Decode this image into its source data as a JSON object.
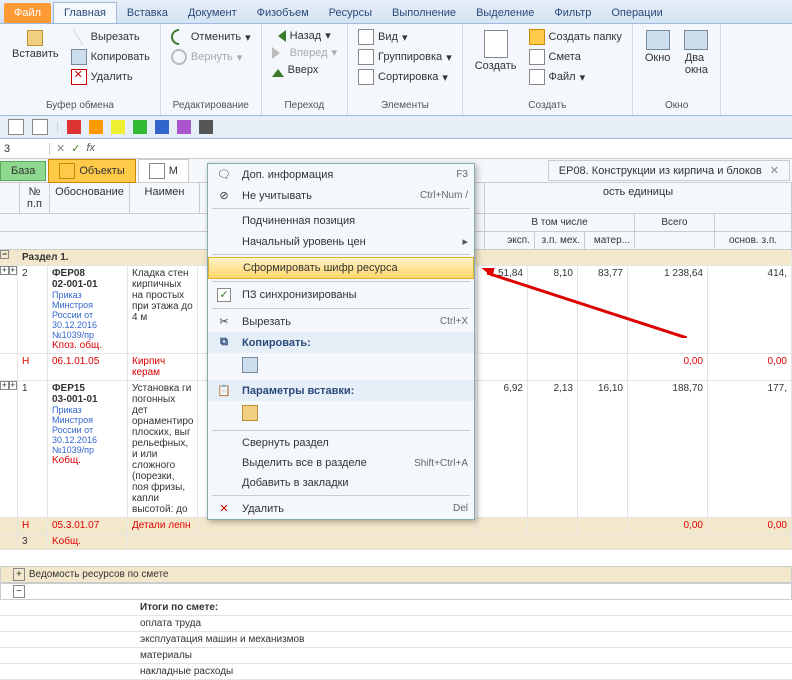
{
  "menu": {
    "file": "Файл",
    "main": "Главная",
    "insert": "Вставка",
    "doc": "Документ",
    "phys": "Физобъем",
    "res": "Ресурсы",
    "exec": "Выполнение",
    "sel": "Выделение",
    "filter": "Фильтр",
    "ops": "Операции"
  },
  "ribbon": {
    "clipboard": {
      "paste": "Вставить",
      "cut": "Вырезать",
      "copy": "Копировать",
      "del": "Удалить",
      "label": "Буфер обмена"
    },
    "edit": {
      "undo": "Отменить",
      "redo": "Вернуть",
      "label": "Редактирование"
    },
    "nav": {
      "back": "Назад",
      "forward": "Вперед",
      "up": "Вверх",
      "label": "Переход"
    },
    "elem": {
      "view": "Вид",
      "group": "Группировка",
      "sort": "Сортировка",
      "label": "Элементы"
    },
    "create": {
      "create": "Создать",
      "mkdir": "Создать папку",
      "estimate": "Смета",
      "file": "Файл",
      "label": "Создать"
    },
    "win": {
      "window": "Окно",
      "two": "Два\nокна",
      "label": "Окно"
    }
  },
  "formula": {
    "addr": "3"
  },
  "doctabs": {
    "base": "База",
    "obj": "Объекты",
    "m": "М",
    "fer": "ЕР08. Конструкции из кирпича и блоков"
  },
  "gridhead": {
    "npp": "№\nп.п",
    "base": "Обоснование",
    "name": "Наимен",
    "costunit": "ость единицы",
    "incl": "В том числе",
    "total": "Всего",
    "eksp": "эксп.",
    "zpmeh": "з.п. мех.",
    "mater": "матер...",
    "osnov": "основ. з.п."
  },
  "rows": {
    "sec": "Раздел 1.",
    "r2": {
      "n": "2",
      "code": "ФЕР08\n02-001-01",
      "ref": "Приказ Минстроя России от 30.12.2016 №1039/пр",
      "k": "Kпоз. общ.",
      "name": "Кладка стен кирпичных на простых при этажа до 4 м",
      "v1": "51,84",
      "v2": "8,10",
      "v3": "83,77",
      "v4": "1 238,64",
      "v5": "414,"
    },
    "rH1": {
      "h": "Н",
      "code": "06.1.01.05",
      "name": "Кирпич керам",
      "v4": "0,00",
      "v5": "0,00"
    },
    "r1": {
      "n": "1",
      "code": "ФЕР15\n03-001-01",
      "ref": "Приказ Минстроя России от 30.12.2016 №1039/пр",
      "k": "Kобщ.",
      "name": "Установка ги погонных дет орнаментиро плоских, выг рельефных, и или сложного (порезки, поя фризы, капли высотой: до",
      "v1": "6,92",
      "v2": "2,13",
      "v3": "16,10",
      "v4": "188,70",
      "v5": "177,"
    },
    "rH2": {
      "h": "Н",
      "code": "05.3.01.07",
      "name": "Детали лепн",
      "v4": "0,00",
      "v5": "0,00"
    },
    "r3": {
      "n": "3",
      "k": "Kобщ."
    }
  },
  "ctx": {
    "info": "Доп. информация",
    "info_sc": "F3",
    "skip": "Не учитывать",
    "skip_sc": "Ctrl+Num /",
    "sub": "Подчиненная позиция",
    "price": "Начальный уровень цен",
    "form": "Сформировать шифр ресурса",
    "sync": "ПЗ синхронизированы",
    "cut": "Вырезать",
    "cut_sc": "Ctrl+X",
    "copy": "Копировать:",
    "pparams": "Параметры вставки:",
    "collapse": "Свернуть раздел",
    "selall": "Выделить все в разделе",
    "selall_sc": "Shift+Ctrl+A",
    "bmark": "Добавить в закладки",
    "del": "Удалить",
    "del_sc": "Del"
  },
  "summary": {
    "head": "Ведомость ресурсов по смете",
    "title": "Итоги по смете:",
    "s1": "оплата труда",
    "s2": "эксплуатация машин и механизмов",
    "s3": "материалы",
    "s4": "накладные расходы"
  }
}
